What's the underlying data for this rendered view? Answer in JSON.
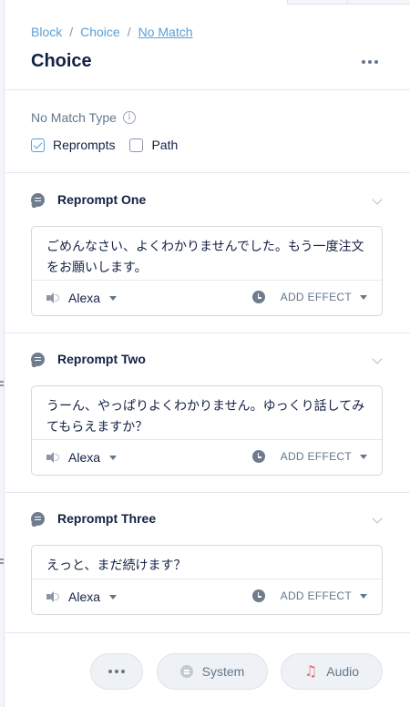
{
  "breadcrumb": {
    "items": [
      "Block",
      "Choice",
      "No Match"
    ]
  },
  "header": {
    "title": "Choice"
  },
  "no_match": {
    "label": "No Match Type",
    "options": [
      {
        "label": "Reprompts",
        "checked": true
      },
      {
        "label": "Path",
        "checked": false
      }
    ]
  },
  "reprompts": [
    {
      "title": "Reprompt One",
      "text": "ごめんなさい、よくわかりませんでした。もう一度注文をお願いします。",
      "voice": "Alexa",
      "effect_label": "ADD EFFECT"
    },
    {
      "title": "Reprompt Two",
      "text": "うーん、やっぱりよくわかりません。ゆっくり話してみてもらえますか？",
      "voice": "Alexa",
      "effect_label": "ADD EFFECT"
    },
    {
      "title": "Reprompt Three",
      "text": "えっと、まだ続けます？",
      "voice": "Alexa",
      "effect_label": "ADD EFFECT"
    }
  ],
  "footer": {
    "system_label": "System",
    "audio_label": "Audio"
  },
  "icons": [
    "chat-bubble-icon",
    "speaker-icon",
    "clock-icon",
    "info-icon",
    "more-icon",
    "chevron-down-icon",
    "music-note-icon"
  ],
  "colors": {
    "link": "#5b9fd7",
    "text": "#132144",
    "muted": "#62778c",
    "audio_accent": "#e8657a"
  }
}
